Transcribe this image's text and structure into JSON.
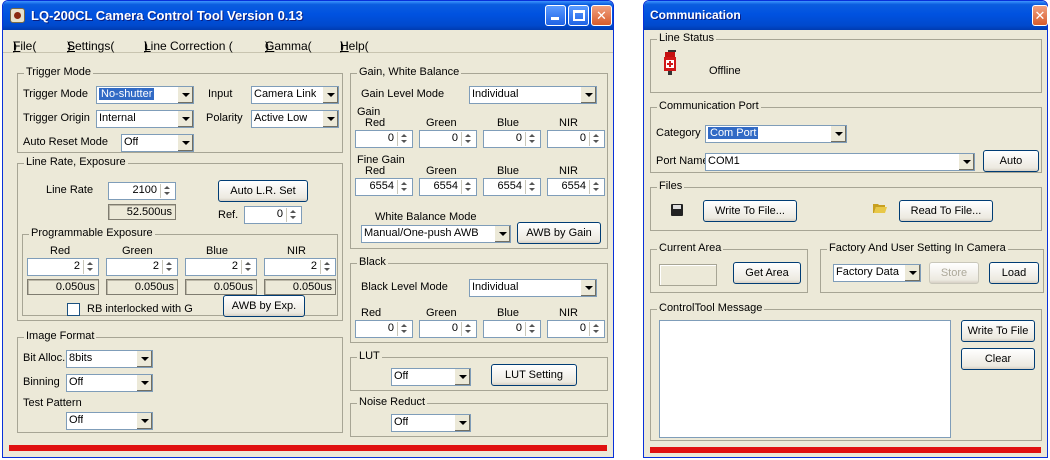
{
  "main": {
    "title": "LQ-200CL Camera Control Tool   Version 0.13",
    "menu": {
      "file": "File(",
      "file_key": "F",
      "settings": "Settings(",
      "settings_key": "S",
      "line_correction": "Line Correction (",
      "line_correction_key": "L",
      "gamma": "Gamma(",
      "gamma_key": "G",
      "help": "Help(",
      "help_key": "H",
      "close_paren": ")"
    },
    "trigger_mode": {
      "legend": "Trigger Mode",
      "trigger_mode_label": "Trigger Mode",
      "trigger_mode_value": "No-shutter",
      "input_label": "Input",
      "input_value": "Camera Link",
      "trigger_origin_label": "Trigger Origin",
      "trigger_origin_value": "Internal",
      "polarity_label": "Polarity",
      "polarity_value": "Active Low",
      "auto_reset_label": "Auto Reset Mode",
      "auto_reset_value": "Off"
    },
    "line_rate": {
      "legend": "Line Rate, Exposure",
      "line_rate_label": "Line Rate",
      "line_rate_value": "2100",
      "line_rate_readout": "52.500us",
      "auto_lr_button": "Auto L.R. Set",
      "ref_label": "Ref.",
      "ref_value": "0",
      "prog_legend": "Programmable Exposure",
      "headers": [
        "Red",
        "Green",
        "Blue",
        "NIR"
      ],
      "values": [
        "2",
        "2",
        "2",
        "2"
      ],
      "readouts": [
        "0.050us",
        "0.050us",
        "0.050us",
        "0.050us"
      ],
      "rb_label": "RB interlocked with G",
      "awb_exp_button": "AWB by Exp."
    },
    "image_format": {
      "legend": "Image Format",
      "bit_alloc_label": "Bit Alloc.",
      "bit_alloc_value": "8bits",
      "binning_label": "Binning",
      "binning_value": "Off",
      "test_pattern_label": "Test Pattern",
      "test_pattern_value": "Off"
    },
    "gain_wb": {
      "legend": "Gain, White Balance",
      "gain_level_label": "Gain Level Mode",
      "gain_level_value": "Individual",
      "gain_label": "Gain",
      "headers": [
        "Red",
        "Green",
        "Blue",
        "NIR"
      ],
      "gain_values": [
        "0",
        "0",
        "0",
        "0"
      ],
      "fine_gain_label": "Fine Gain",
      "fine_gain_values": [
        "6554",
        "6554",
        "6554",
        "6554"
      ],
      "wb_mode_label": "White Balance Mode",
      "wb_mode_value": "Manual/One-push AWB",
      "awb_gain_button": "AWB by Gain"
    },
    "black": {
      "legend": "Black",
      "level_label": "Black Level Mode",
      "level_value": "Individual",
      "headers": [
        "Red",
        "Green",
        "Blue",
        "NIR"
      ],
      "values": [
        "0",
        "0",
        "0",
        "0"
      ]
    },
    "lut": {
      "legend": "LUT",
      "value": "Off",
      "button": "LUT Setting"
    },
    "noise": {
      "legend": "Noise Reduct",
      "value": "Off"
    }
  },
  "comm": {
    "title": "Communication",
    "line_status": {
      "legend": "Line Status",
      "status": "Offline"
    },
    "port": {
      "legend": "Communication Port",
      "category_label": "Category",
      "category_value": "Com Port",
      "port_name_label": "Port Name",
      "port_name_value": "COM1",
      "auto_button": "Auto"
    },
    "files": {
      "legend": "Files",
      "write_button": "Write To File...",
      "read_button": "Read To File..."
    },
    "current_area": {
      "legend": "Current Area",
      "get_button": "Get Area"
    },
    "factory": {
      "legend": "Factory And User Setting In Camera",
      "value": "Factory Data",
      "store_button": "Store",
      "load_button": "Load"
    },
    "message": {
      "legend": "ControlTool Message",
      "write_button": "Write To File",
      "clear_button": "Clear"
    }
  },
  "colors": {
    "title_blue": "#0052e0",
    "panel_bg": "#ece9d8",
    "selection": "#316ac5",
    "status_red": "#e01010"
  }
}
